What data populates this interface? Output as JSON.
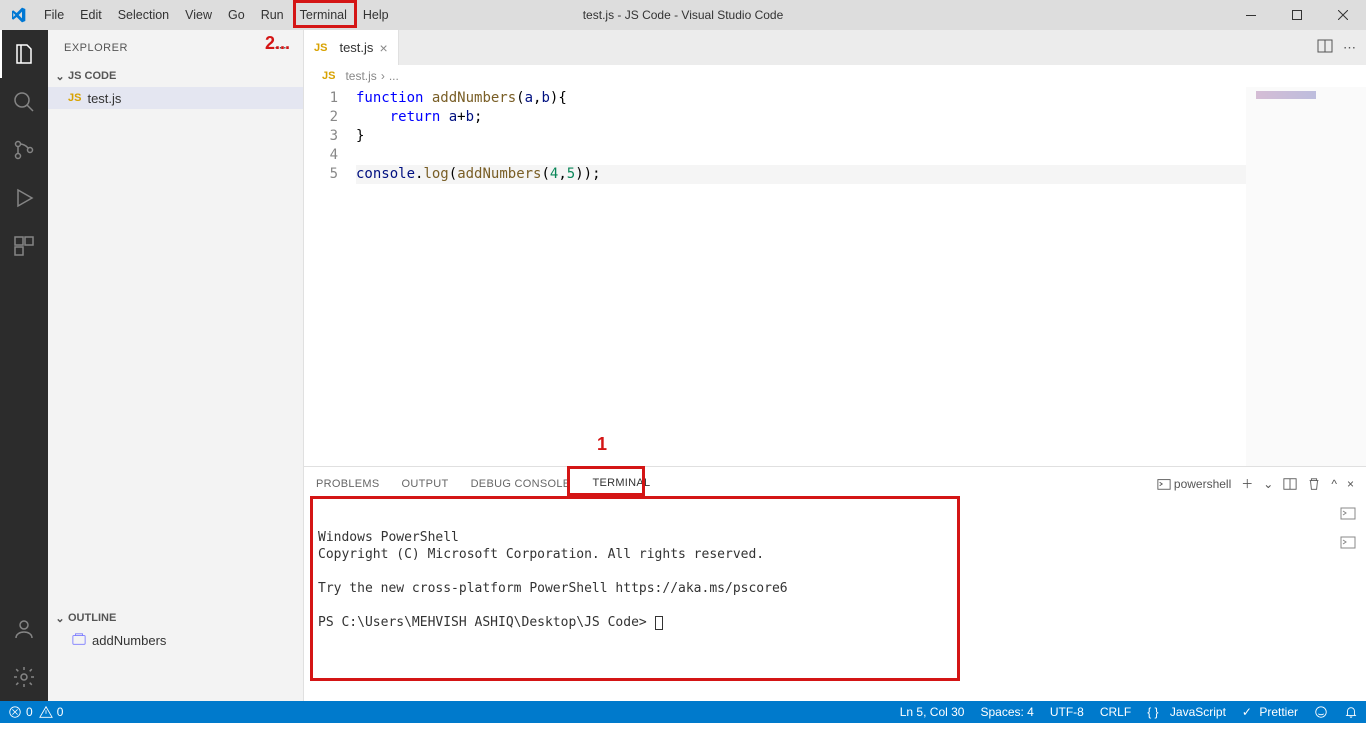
{
  "title": "test.js - JS Code - Visual Studio Code",
  "annotations": {
    "one": "1",
    "two": "2..."
  },
  "menu": {
    "file": "File",
    "edit": "Edit",
    "selection": "Selection",
    "view": "View",
    "go": "Go",
    "run": "Run",
    "terminal": "Terminal",
    "help": "Help"
  },
  "explorer": {
    "title": "EXPLORER",
    "project": "JS CODE",
    "file": "test.js",
    "outline": "OUTLINE",
    "symbol": "addNumbers"
  },
  "tab": {
    "name": "test.js"
  },
  "breadcrumb": {
    "file": "test.js",
    "sep": "›",
    "rest": "..."
  },
  "code": {
    "lines": [
      "1",
      "2",
      "3",
      "4",
      "5"
    ]
  },
  "panel_tabs": {
    "problems": "PROBLEMS",
    "output": "OUTPUT",
    "debug": "DEBUG CONSOLE",
    "terminal": "TERMINAL"
  },
  "panel_actions": {
    "shell": "powershell"
  },
  "terminal_text": "\nWindows PowerShell\nCopyright (C) Microsoft Corporation. All rights reserved.\n\nTry the new cross-platform PowerShell https://aka.ms/pscore6\n\nPS C:\\Users\\MEHVISH ASHIQ\\Desktop\\JS Code> ",
  "status": {
    "errors": "0",
    "warnings": "0",
    "lncol": "Ln 5, Col 30",
    "spaces": "Spaces: 4",
    "encoding": "UTF-8",
    "eol": "CRLF",
    "lang": "JavaScript",
    "prettier": "Prettier"
  }
}
